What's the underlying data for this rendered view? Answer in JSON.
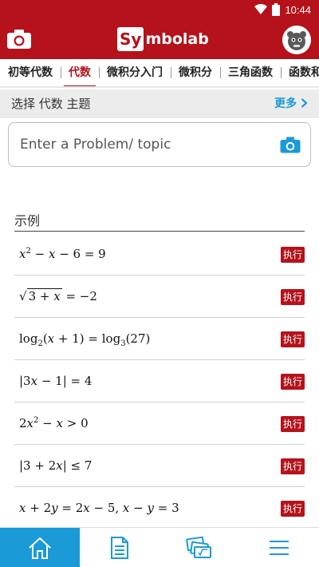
{
  "status": {
    "time": "10:44"
  },
  "app": {
    "logo_box": "Sy",
    "logo_rest": "mbolab",
    "brand_color": "#b5121b",
    "link_color": "#1a9ad6"
  },
  "tabs": [
    {
      "label": "初等代数",
      "active": false
    },
    {
      "label": "代数",
      "active": true
    },
    {
      "label": "微积分入门",
      "active": false
    },
    {
      "label": "微积分",
      "active": false
    },
    {
      "label": "三角函数",
      "active": false
    },
    {
      "label": "函数和",
      "active": false
    }
  ],
  "subject": {
    "title": "选择 代数 主题",
    "more": "更多"
  },
  "search": {
    "placeholder": "Enter a Problem/ topic"
  },
  "examples": {
    "heading": "示例",
    "go_label": "执行",
    "items": [
      {
        "text": "x^2 - x - 6 = 9"
      },
      {
        "text": "√(3 + x) = -2"
      },
      {
        "text": "log_2(x+1) = log_3(27)"
      },
      {
        "text": "|3x - 1| = 4"
      },
      {
        "text": "2x^2 - x > 0"
      },
      {
        "text": "|3 + 2x| ≤ 7"
      },
      {
        "text": "x + 2y = 2x - 5, x - y = 3"
      }
    ]
  },
  "bottom_nav": [
    {
      "icon": "home-icon",
      "active": true
    },
    {
      "icon": "notebook-icon",
      "active": false
    },
    {
      "icon": "practice-icon",
      "active": false
    },
    {
      "icon": "menu-icon",
      "active": false
    }
  ]
}
